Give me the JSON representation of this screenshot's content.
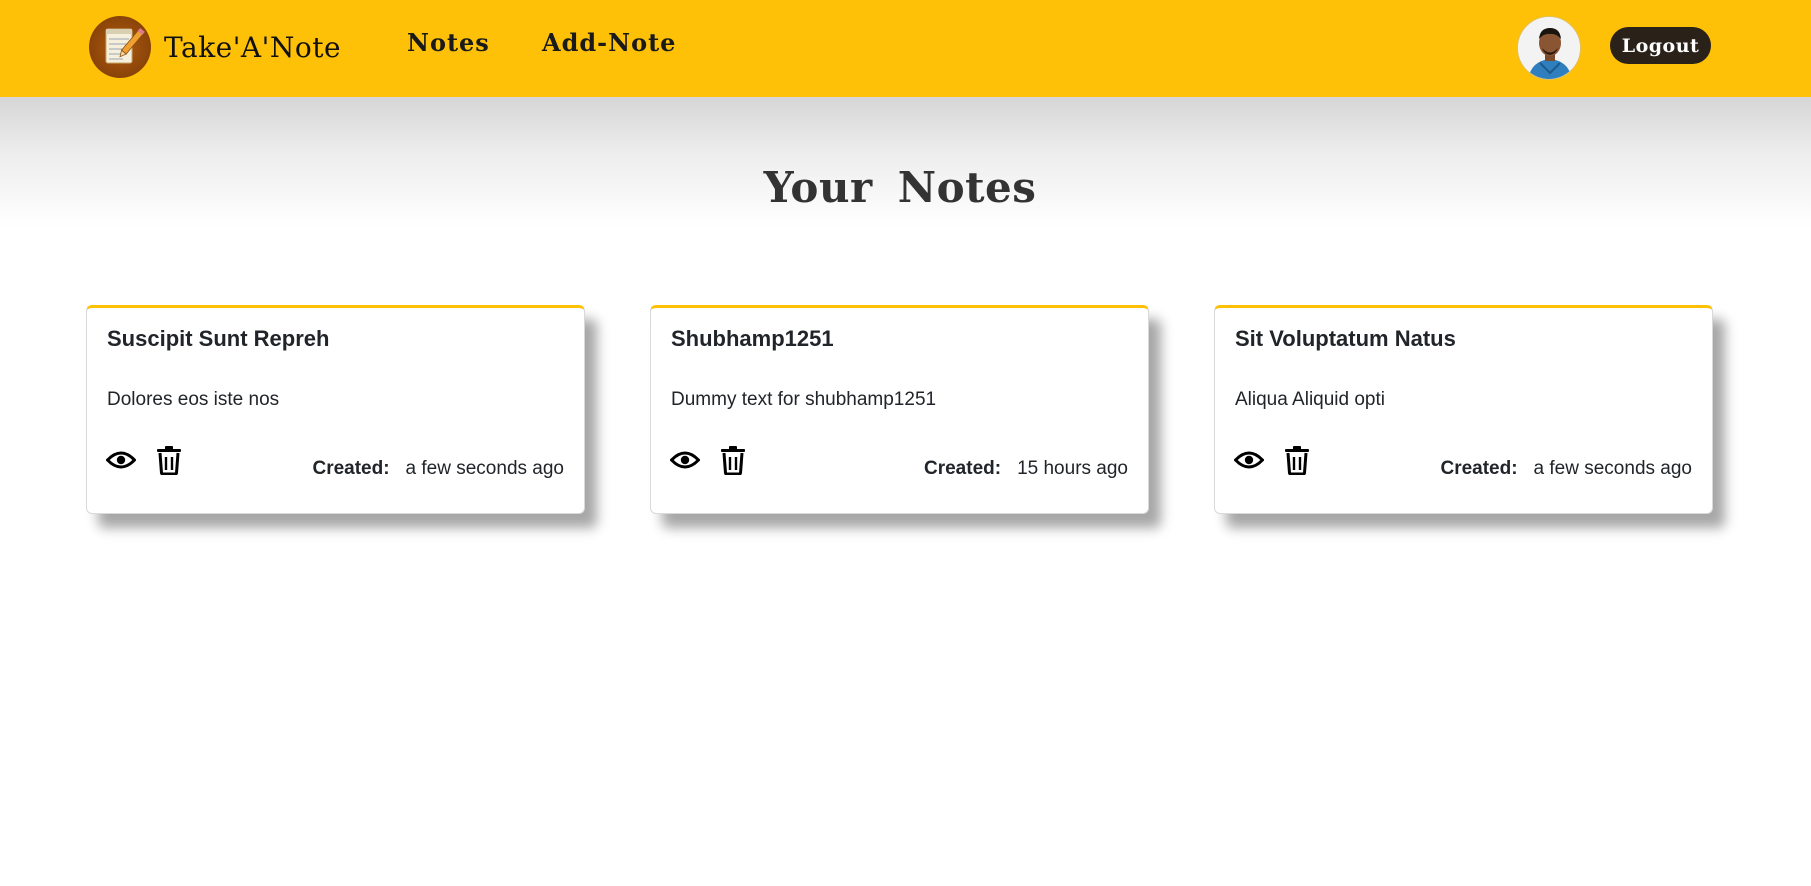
{
  "navbar": {
    "brand_name": "Take'A'Note",
    "links": [
      "Notes",
      "Add-Note"
    ],
    "logout_label": "Logout",
    "accent_color": "#ffc107"
  },
  "page": {
    "title": "Your  Notes"
  },
  "notes": [
    {
      "title": "Suscipit Sunt Repreh",
      "description": "Dolores eos iste nos",
      "created_label": "Created:",
      "created_value": "a few seconds ago"
    },
    {
      "title": "Shubhamp1251",
      "description": "Dummy text for shubhamp1251",
      "created_label": "Created:",
      "created_value": "15 hours ago"
    },
    {
      "title": "Sit Voluptatum Natus",
      "description": "Aliqua Aliquid opti",
      "created_label": "Created:",
      "created_value": "a few seconds ago"
    }
  ],
  "icons": {
    "view": "eye-icon",
    "delete": "trash-icon",
    "logo": "notepad-pencil-icon",
    "avatar": "user-avatar"
  }
}
